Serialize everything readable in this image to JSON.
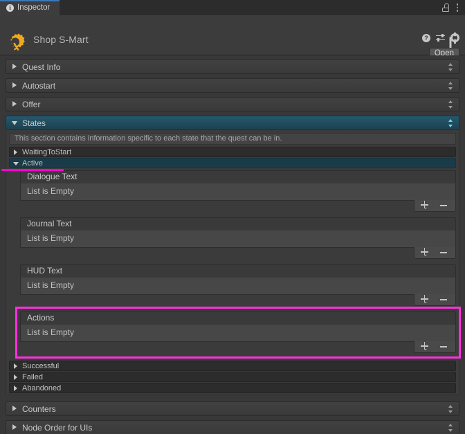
{
  "window": {
    "tab_label": "Inspector",
    "tab_icon": "info-icon",
    "lock_icon": "lock-icon",
    "menu_icon": "kebab-menu-icon"
  },
  "object_header": {
    "title": "Shop S-Mart",
    "icon": "quest-gear-icon",
    "help_icon": "help-icon",
    "preset_icon": "preset-sliders-icon",
    "settings_icon": "gear-icon",
    "open_button": "Open"
  },
  "sections": [
    {
      "label": "Quest Info",
      "expanded": false
    },
    {
      "label": "Autostart",
      "expanded": false
    },
    {
      "label": "Offer",
      "expanded": false
    },
    {
      "label": "States",
      "expanded": true
    }
  ],
  "states": {
    "help_text": "This section contains information specific to each state that the quest can be in.",
    "rows_top": [
      {
        "label": "WaitingToStart",
        "expanded": false,
        "selected": false
      },
      {
        "label": "Active",
        "expanded": true,
        "selected": true
      }
    ],
    "lists": [
      {
        "label": "Dialogue Text",
        "empty_text": "List is Empty",
        "highlighted": false
      },
      {
        "label": "Journal Text",
        "empty_text": "List is Empty",
        "highlighted": false
      },
      {
        "label": "HUD Text",
        "empty_text": "List is Empty",
        "highlighted": false
      },
      {
        "label": "Actions",
        "empty_text": "List is Empty",
        "highlighted": true
      }
    ],
    "rows_bottom": [
      {
        "label": "Successful",
        "expanded": false,
        "selected": false
      },
      {
        "label": "Failed",
        "expanded": false,
        "selected": false
      },
      {
        "label": "Abandoned",
        "expanded": false,
        "selected": false
      }
    ]
  },
  "bottom_sections": [
    {
      "label": "Counters",
      "expanded": false
    },
    {
      "label": "Node Order for UIs",
      "expanded": false
    }
  ],
  "list_buttons": {
    "add": "add-list-item-button",
    "remove": "remove-list-item-button"
  },
  "colors": {
    "background": "#383838",
    "panel": "#3c3c3c",
    "accent_blue": "#25586c",
    "tab_highlight": "#3a79bb",
    "highlight_magenta": "#ff2fdf",
    "icon_orange": "#f0a81e",
    "text": "#c4c4c4"
  }
}
